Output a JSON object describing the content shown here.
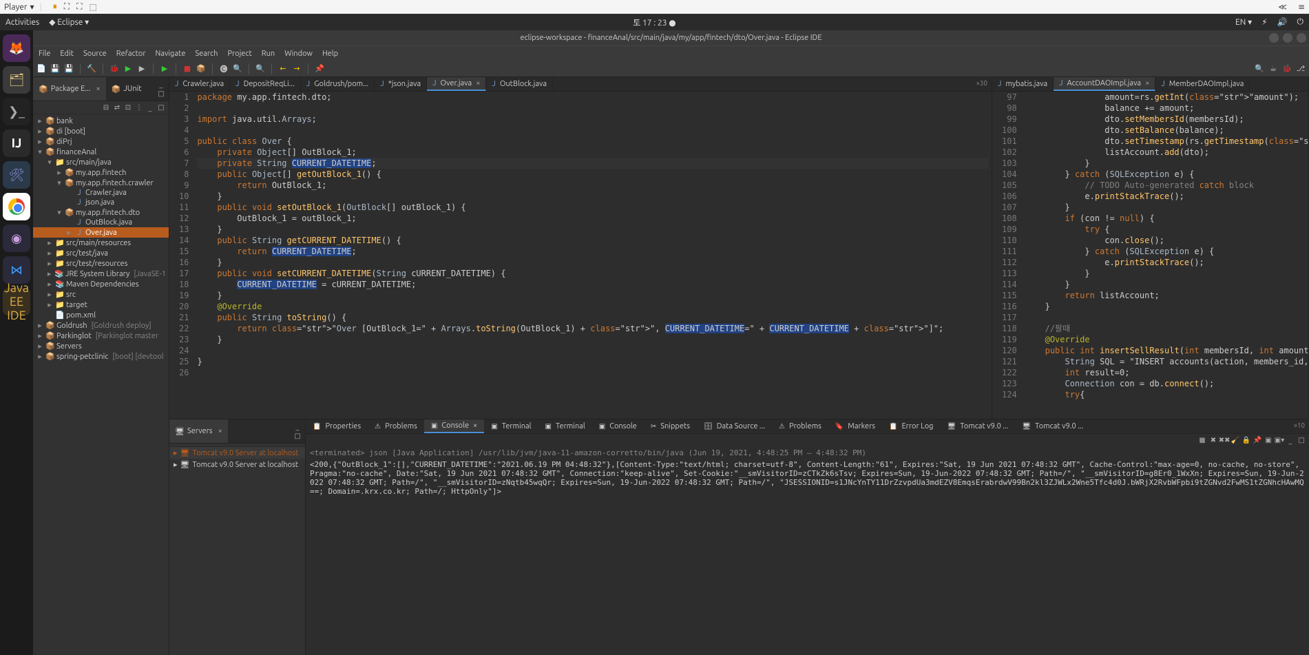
{
  "winbar": {
    "player": "Player",
    "arrow": "▾"
  },
  "topbar": {
    "activities": "Activities",
    "app": "Eclipse",
    "time": "토 17 : 23 ●",
    "lang": "EN ▾"
  },
  "title": "eclipse-workspace - financeAnal/src/main/java/my/app/fintech/dto/Over.java - Eclipse IDE",
  "menubar": [
    "File",
    "Edit",
    "Source",
    "Refactor",
    "Navigate",
    "Search",
    "Project",
    "Run",
    "Window",
    "Help"
  ],
  "sidebar": {
    "tabs": [
      {
        "label": "Package E...",
        "active": true,
        "closable": true
      },
      {
        "label": "JUnit",
        "active": false
      }
    ],
    "tree": [
      {
        "depth": 0,
        "tw": "▸",
        "icon": "📦",
        "iclass": "icon-proj",
        "label": "bank"
      },
      {
        "depth": 0,
        "tw": "▸",
        "icon": "📦",
        "iclass": "icon-proj",
        "label": "di [boot]"
      },
      {
        "depth": 0,
        "tw": "▸",
        "icon": "📦",
        "iclass": "icon-proj",
        "label": "diPrj"
      },
      {
        "depth": 0,
        "tw": "▾",
        "icon": "📦",
        "iclass": "icon-proj",
        "label": "financeAnal"
      },
      {
        "depth": 1,
        "tw": "▾",
        "icon": "📁",
        "iclass": "icon-folder",
        "label": "src/main/java"
      },
      {
        "depth": 2,
        "tw": "▸",
        "icon": "📦",
        "iclass": "icon-pkg",
        "label": "my.app.fintech"
      },
      {
        "depth": 2,
        "tw": "▾",
        "icon": "📦",
        "iclass": "icon-pkg",
        "label": "my.app.fintech.crawler"
      },
      {
        "depth": 3,
        "tw": "",
        "icon": "J",
        "iclass": "icon-file",
        "label": "Crawler.java"
      },
      {
        "depth": 3,
        "tw": "",
        "icon": "J",
        "iclass": "icon-file",
        "label": "json.java"
      },
      {
        "depth": 2,
        "tw": "▾",
        "icon": "📦",
        "iclass": "icon-pkg",
        "label": "my.app.fintech.dto"
      },
      {
        "depth": 3,
        "tw": "",
        "icon": "J",
        "iclass": "icon-file",
        "label": "OutBlock.java"
      },
      {
        "depth": 3,
        "tw": "▸",
        "icon": "J",
        "iclass": "icon-file",
        "label": "Over.java",
        "sel": true
      },
      {
        "depth": 1,
        "tw": "▸",
        "icon": "📁",
        "iclass": "icon-folder",
        "label": "src/main/resources"
      },
      {
        "depth": 1,
        "tw": "▸",
        "icon": "📁",
        "iclass": "icon-folder",
        "label": "src/test/java"
      },
      {
        "depth": 1,
        "tw": "▸",
        "icon": "📁",
        "iclass": "icon-folder",
        "label": "src/test/resources"
      },
      {
        "depth": 1,
        "tw": "▸",
        "icon": "📚",
        "iclass": "icon-folder",
        "label": "JRE System Library",
        "extra": "[JavaSE-1"
      },
      {
        "depth": 1,
        "tw": "▸",
        "icon": "📚",
        "iclass": "icon-folder",
        "label": "Maven Dependencies"
      },
      {
        "depth": 1,
        "tw": "▸",
        "icon": "📁",
        "iclass": "icon-folder",
        "label": "src"
      },
      {
        "depth": 1,
        "tw": "▸",
        "icon": "📁",
        "iclass": "icon-folder",
        "label": "target"
      },
      {
        "depth": 1,
        "tw": "",
        "icon": "📄",
        "iclass": "icon-file",
        "label": "pom.xml"
      },
      {
        "depth": 0,
        "tw": "▸",
        "icon": "📦",
        "iclass": "icon-proj",
        "label": "Goldrush",
        "extra": "[Goldrush deploy]"
      },
      {
        "depth": 0,
        "tw": "▸",
        "icon": "📦",
        "iclass": "icon-proj",
        "label": "Parkinglot",
        "extra": "[Parkinglot master"
      },
      {
        "depth": 0,
        "tw": "▸",
        "icon": "📦",
        "iclass": "icon-proj",
        "label": "Servers"
      },
      {
        "depth": 0,
        "tw": "▸",
        "icon": "📦",
        "iclass": "icon-proj",
        "label": "spring-petclinic",
        "extra": "[boot] [devtool"
      }
    ]
  },
  "editors": {
    "left": {
      "tabs": [
        {
          "label": "Crawler.java"
        },
        {
          "label": "DepositReqLi..."
        },
        {
          "label": "Goldrush/pom..."
        },
        {
          "label": "*json.java"
        },
        {
          "label": "Over.java",
          "active": true,
          "close": true
        },
        {
          "label": "OutBlock.java"
        }
      ],
      "overflow": "»30"
    },
    "right": {
      "tabs": [
        {
          "label": "mybatis.java"
        },
        {
          "label": "AccountDAOImpl.java",
          "active": true,
          "close": true
        },
        {
          "label": "MemberDAOImpl.java"
        }
      ]
    }
  },
  "code_left": {
    "start": 1,
    "lines": [
      "package my.app.fintech.dto;",
      "",
      "import java.util.Arrays;",
      "",
      "public class Over {",
      "    private Object[] OutBlock_1;",
      "    private String CURRENT_DATETIME;",
      "    public Object[] getOutBlock_1() {",
      "        return OutBlock_1;",
      "    }",
      "    public void setOutBlock_1(OutBlock[] outBlock_1) {",
      "        OutBlock_1 = outBlock_1;",
      "    }",
      "    public String getCURRENT_DATETIME() {",
      "        return CURRENT_DATETIME;",
      "    }",
      "    public void setCURRENT_DATETIME(String cURRENT_DATETIME) {",
      "        CURRENT_DATETIME = cURRENT_DATETIME;",
      "    }",
      "    @Override",
      "    public String toString() {",
      "        return \"Over [OutBlock_1=\" + Arrays.toString(OutBlock_1) + \", CURRENT_DATETIME=\" + CURRENT_DATETIME + \"]\";",
      "    }",
      "    ",
      "}",
      ""
    ]
  },
  "code_right": {
    "start": 97,
    "lines": [
      "                amount=rs.getInt(\"amount\");",
      "                balance += amount;",
      "                dto.setMembersId(membersId);",
      "                dto.setBalance(balance);",
      "                dto.setTimestamp(rs.getTimestamp(\"time_stamp\"));",
      "                listAccount.add(dto);",
      "            }",
      "        } catch (SQLException e) {",
      "            // TODO Auto-generated catch block",
      "            e.printStackTrace();",
      "        }",
      "        if (con != null) {",
      "            try {",
      "                con.close();",
      "            } catch (SQLException e) {",
      "                e.printStackTrace();",
      "            }",
      "        }",
      "        return listAccount;",
      "    }",
      "    ",
      "    //팔때",
      "    @Override",
      "    public int insertSellResult(int membersId, int amount) {",
      "        String SQL = \"INSERT accounts(action, members_id, amoun",
      "        int result=0;",
      "        Connection con = db.connect();",
      "        try{"
    ]
  },
  "bottom": {
    "tabs": [
      {
        "label": "Properties",
        "icon": "📋"
      },
      {
        "label": "Problems",
        "icon": "⚠"
      },
      {
        "label": "Console",
        "icon": "▣",
        "active": true,
        "close": true
      },
      {
        "label": "Terminal",
        "icon": "▣"
      },
      {
        "label": "Terminal",
        "icon": "▣"
      },
      {
        "label": "Console",
        "icon": "▣"
      },
      {
        "label": "Snippets",
        "icon": "✂"
      },
      {
        "label": "Data Source ...",
        "icon": "🗄"
      },
      {
        "label": "Problems",
        "icon": "⚠"
      },
      {
        "label": "Markers",
        "icon": "🔖"
      },
      {
        "label": "Error Log",
        "icon": "📋"
      },
      {
        "label": "Tomcat v9.0 ...",
        "icon": "🖥"
      },
      {
        "label": "Tomcat v9.0 ...",
        "icon": "🖥"
      }
    ],
    "overflow": "»10",
    "console_header": "<terminated> json [Java Application] /usr/lib/jvm/java-11-amazon-corretto/bin/java  (Jun 19, 2021, 4:48:25 PM – 4:48:32 PM)",
    "console_body": "<200,{\"OutBlock_1\":[],\"CURRENT_DATETIME\":\"2021.06.19 PM 04:48:32\"},[Content-Type:\"text/html; charset=utf-8\", Content-Length:\"61\", Expires:\"Sat, 19 Jun 2021 07:48:32 GMT\", Cache-Control:\"max-age=0, no-cache, no-store\", Pragma:\"no-cache\", Date:\"Sat, 19 Jun 2021 07:48:32 GMT\", Connection:\"keep-alive\", Set-Cookie:\"__smVisitorID=zCTkZk6sTsv; Expires=Sun, 19-Jun-2022 07:48:32 GMT; Path=/\", \"__smVisitorID=g8Er0_1WxXn; Expires=Sun, 19-Jun-2022 07:48:32 GMT; Path=/\", \"__smVisitorID=zNqtb45wqQr; Expires=Sun, 19-Jun-2022 07:48:32 GMT; Path=/\", \"JSESSIONID=s1JNcYnTY11DrZzvpdUa3mdEZV8EmqsErabrdwV99Bn2kl3ZJWLx2Wne5Tfc4d0J.bWRjX2RvbWFpbi9tZGNvd2FwMS1tZGNhcHAwMQ==; Domain=.krx.co.kr; Path=/; HttpOnly\"]>"
  },
  "servers": {
    "tab": "Servers",
    "items": [
      {
        "label": "Tomcat v9.0 Server at localhost",
        "running": true
      },
      {
        "label": "Tomcat v9.0 Server at localhost",
        "running": false
      }
    ]
  }
}
